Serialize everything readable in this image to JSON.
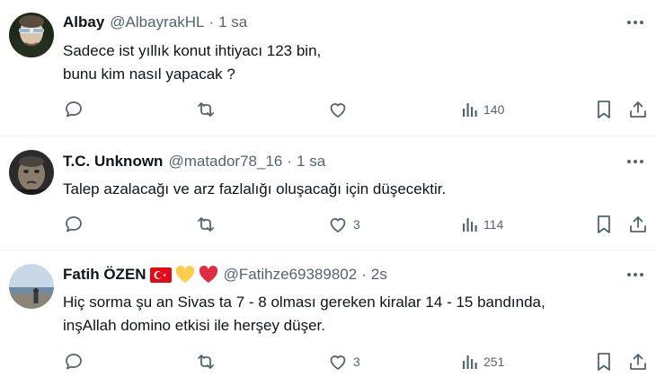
{
  "tweets": [
    {
      "name": "Albay",
      "handle": "@AlbayrakHL",
      "separator": "·",
      "time": "1 sa",
      "lines": [
        "Sadece ist yıllık konut ihtiyacı 123 bin,",
        "bunu kim nasıl yapacak ?"
      ],
      "reply_count": "",
      "retweet_count": "",
      "like_count": "",
      "view_count": "140"
    },
    {
      "name": "T.C. Unknown",
      "handle": "@matador78_16",
      "separator": "·",
      "time": "1 sa",
      "lines": [
        "Talep azalacağı ve arz fazlalığı oluşacağı için düşecektir."
      ],
      "reply_count": "",
      "retweet_count": "",
      "like_count": "3",
      "view_count": "114"
    },
    {
      "name": "Fatih ÖZEN",
      "handle": "@Fatihze69389802",
      "separator": "·",
      "time": "2s",
      "name_emojis": [
        "turkey-flag",
        "yellow-heart",
        "red-heart"
      ],
      "lines": [
        "Hiç sorma şu an Sivas ta 7 - 8  olması gereken kiralar 14 - 15 bandında,",
        "inşAllah domino etkisi ile herşey düşer."
      ],
      "reply_count": "",
      "retweet_count": "",
      "like_count": "3",
      "view_count": "251"
    }
  ],
  "icons": {
    "reply": "reply-icon",
    "retweet": "retweet-icon",
    "like": "like-icon",
    "views": "views-icon",
    "bookmark": "bookmark-icon",
    "share": "share-icon",
    "more": "more-icon"
  },
  "colors": {
    "text": "#0f1419",
    "secondary": "#536471",
    "divider": "#eff3f4",
    "heart_red": "#e0245e",
    "heart_yellow": "#ffcc4d",
    "flag_red": "#e30a17"
  }
}
